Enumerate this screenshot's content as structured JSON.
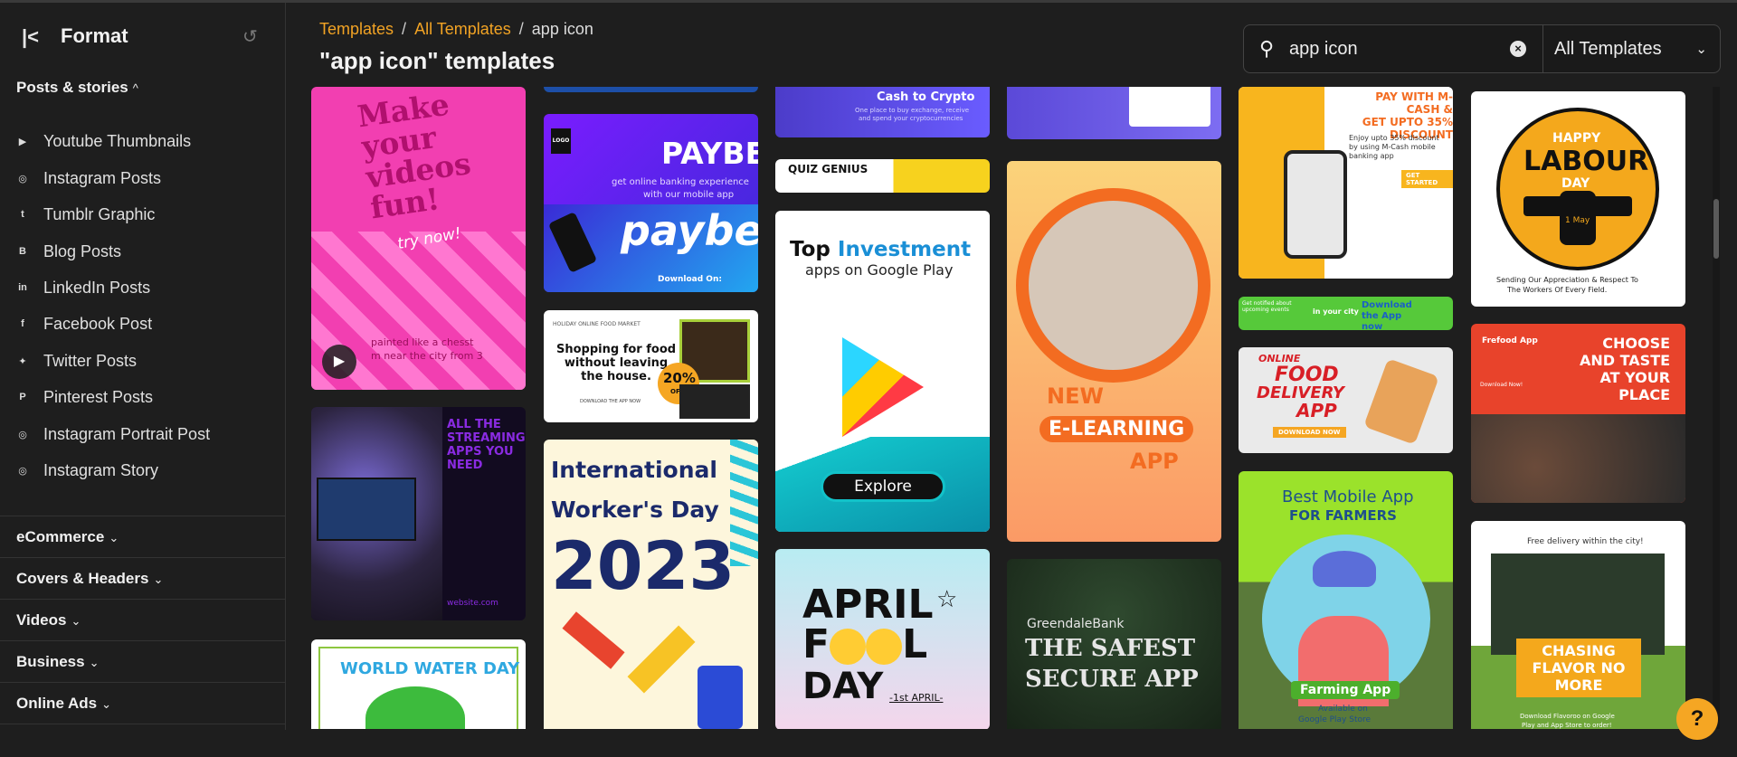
{
  "sidebar": {
    "title": "Format",
    "section_label": "Posts & stories",
    "items": [
      {
        "label": "Youtube Thumbnails",
        "icon": "youtube-icon"
      },
      {
        "label": "Instagram Posts",
        "icon": "instagram-icon"
      },
      {
        "label": "Tumblr Graphic",
        "icon": "tumblr-icon"
      },
      {
        "label": "Blog Posts",
        "icon": "blogger-icon"
      },
      {
        "label": "LinkedIn Posts",
        "icon": "linkedin-icon"
      },
      {
        "label": "Facebook Post",
        "icon": "facebook-icon"
      },
      {
        "label": "Twitter Posts",
        "icon": "twitter-icon"
      },
      {
        "label": "Pinterest Posts",
        "icon": "pinterest-icon"
      },
      {
        "label": "Instagram Portrait Post",
        "icon": "instagram-icon"
      },
      {
        "label": "Instagram Story",
        "icon": "instagram-icon"
      }
    ],
    "categories": [
      "eCommerce",
      "Covers & Headers",
      "Videos",
      "Business",
      "Online Ads"
    ]
  },
  "breadcrumb": {
    "items": [
      "Templates",
      "All Templates",
      "app icon"
    ],
    "separator": "/"
  },
  "page_title": "\"app icon\" templates",
  "search": {
    "value": "app icon",
    "filter": "All Templates"
  },
  "colors": {
    "accent": "#f2a324",
    "background": "#1e1e1e"
  },
  "cards": {
    "c1": {
      "l1": "Make",
      "l2": "your",
      "l3": "videos",
      "l4": "fun!",
      "l5": "try now!",
      "l6": "painted like a chesst",
      "l7": "m near the city from 3"
    },
    "c2": {
      "l1": "ALL THE",
      "l2": "STREAMING",
      "l3": "APPS YOU",
      "l4": "NEED",
      "l5": "website.com"
    },
    "c3": {
      "l1": "WORLD WATER DAY"
    },
    "c4": {
      "l1": "PAYBE",
      "l2": "get online banking experience",
      "l3": "with our mobile app",
      "l4": "paybe",
      "l5": "Download On:",
      "l6": "LOGO"
    },
    "c5": {
      "l1": "Shopping for food",
      "l2": "without leaving",
      "l3": "the house.",
      "l4": "20%",
      "l5": "OFF",
      "l6": "HOLIDAY ONLINE FOOD MARKET",
      "l7": "DOWNLOAD THE APP NOW"
    },
    "c6": {
      "l1": "International",
      "l2": "Worker's Day",
      "l3": "2023"
    },
    "c7": {
      "l1": "Cash to Crypto",
      "l2": "One place to buy exchange, receive",
      "l3": "and spend your cryptocurrencies"
    },
    "c8": {
      "l1": "QUIZ GENIUS"
    },
    "c9": {
      "l1": "Top",
      "l2": "Investment",
      "l3": "apps on Google Play",
      "l4": "Explore"
    },
    "c10": {
      "l1": "APRIL",
      "l2": "F",
      "l3": "L",
      "l4": "DAY",
      "l5": "-1st APRIL-"
    },
    "c11": {
      "l1": "NEW",
      "l2": "E-LEARNING",
      "l3": "APP"
    },
    "c12": {
      "l1": "GreendaleBank",
      "l2": "THE SAFEST",
      "l3": "SECURE APP"
    },
    "c13": {
      "l1": "PAY WITH M-CASH &",
      "l2": "GET UPTO 35%",
      "l3": "DISCOUNT",
      "l4": "Enjoy upto 35% discount",
      "l5": "by using M-Cash mobile",
      "l6": "banking app",
      "l7": "GET STARTED"
    },
    "c14": {
      "l1": "Get notified about upcoming events",
      "l2": "in your city",
      "l3": "Download the App now"
    },
    "c15": {
      "l1": "ONLINE",
      "l2": "FOOD",
      "l3": "DELIVERY",
      "l4": "APP",
      "l5": "DOWNLOAD NOW"
    },
    "c16": {
      "l1": "Best Mobile App",
      "l2": "FOR FARMERS",
      "l3": "Farming App",
      "l4": "Available on",
      "l5": "Google Play Store"
    },
    "c17": {
      "l1": "HAPPY",
      "l2": "LABOUR",
      "l3": "DAY",
      "l4": "1 May",
      "l5": "Sending Our Appreciation & Respect To",
      "l6": "The Workers Of Every Field."
    },
    "c18": {
      "l1": "Frefood App",
      "l2": "CHOOSE",
      "l3": "AND TASTE",
      "l4": "AT YOUR",
      "l5": "PLACE",
      "l6": "Download Now!"
    },
    "c19": {
      "l1": "Free delivery within the city!",
      "l2": "CHASING",
      "l3": "FLAVOR NO",
      "l4": "MORE",
      "l5": "Download Flavoroo on Google",
      "l6": "Play and App Store to order!"
    }
  },
  "help_label": "?"
}
